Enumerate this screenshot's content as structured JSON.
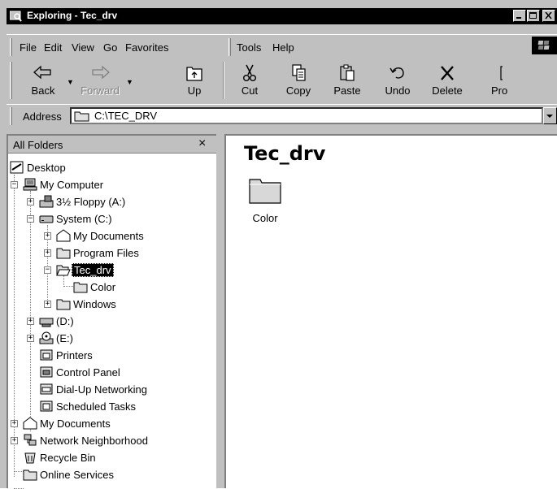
{
  "window": {
    "title": "Exploring - Tec_drv"
  },
  "menu": [
    "File",
    "Edit",
    "View",
    "Go",
    "Favorites",
    "Tools",
    "Help"
  ],
  "toolbar": {
    "back": "Back",
    "forward": "Forward",
    "up": "Up",
    "cut": "Cut",
    "copy": "Copy",
    "paste": "Paste",
    "undo": "Undo",
    "delete": "Delete",
    "properties": "Pro"
  },
  "address": {
    "label": "Address",
    "value": "C:\\TEC_DRV"
  },
  "left_pane": {
    "header": "All Folders",
    "close": "×",
    "tree": [
      {
        "label": "Desktop",
        "icon": "desktop-icon"
      },
      {
        "label": "My Computer",
        "icon": "my-computer-icon"
      },
      {
        "label": "3½ Floppy (A:)",
        "icon": "floppy-drive-icon"
      },
      {
        "label": "System (C:)",
        "icon": "hard-drive-icon"
      },
      {
        "label": "My Documents",
        "icon": "my-documents-folder-icon"
      },
      {
        "label": "Program Files",
        "icon": "folder-icon"
      },
      {
        "label": "Tec_drv",
        "icon": "open-folder-icon"
      },
      {
        "label": "Color",
        "icon": "folder-icon"
      },
      {
        "label": "Windows",
        "icon": "folder-icon"
      },
      {
        "label": "(D:)",
        "icon": "removable-drive-icon"
      },
      {
        "label": "(E:)",
        "icon": "cd-drive-icon"
      },
      {
        "label": "Printers",
        "icon": "printers-icon"
      },
      {
        "label": "Control Panel",
        "icon": "control-panel-icon"
      },
      {
        "label": "Dial-Up Networking",
        "icon": "dial-up-icon"
      },
      {
        "label": "Scheduled Tasks",
        "icon": "scheduled-tasks-icon"
      },
      {
        "label": "My Documents",
        "icon": "my-documents-folder-icon"
      },
      {
        "label": "Network Neighborhood",
        "icon": "network-icon"
      },
      {
        "label": "Recycle Bin",
        "icon": "recycle-bin-icon"
      },
      {
        "label": "Online Services",
        "icon": "folder-icon"
      }
    ]
  },
  "right_pane": {
    "folder_title": "Tec_drv",
    "items": [
      {
        "label": "Color",
        "icon": "folder-icon"
      }
    ]
  }
}
